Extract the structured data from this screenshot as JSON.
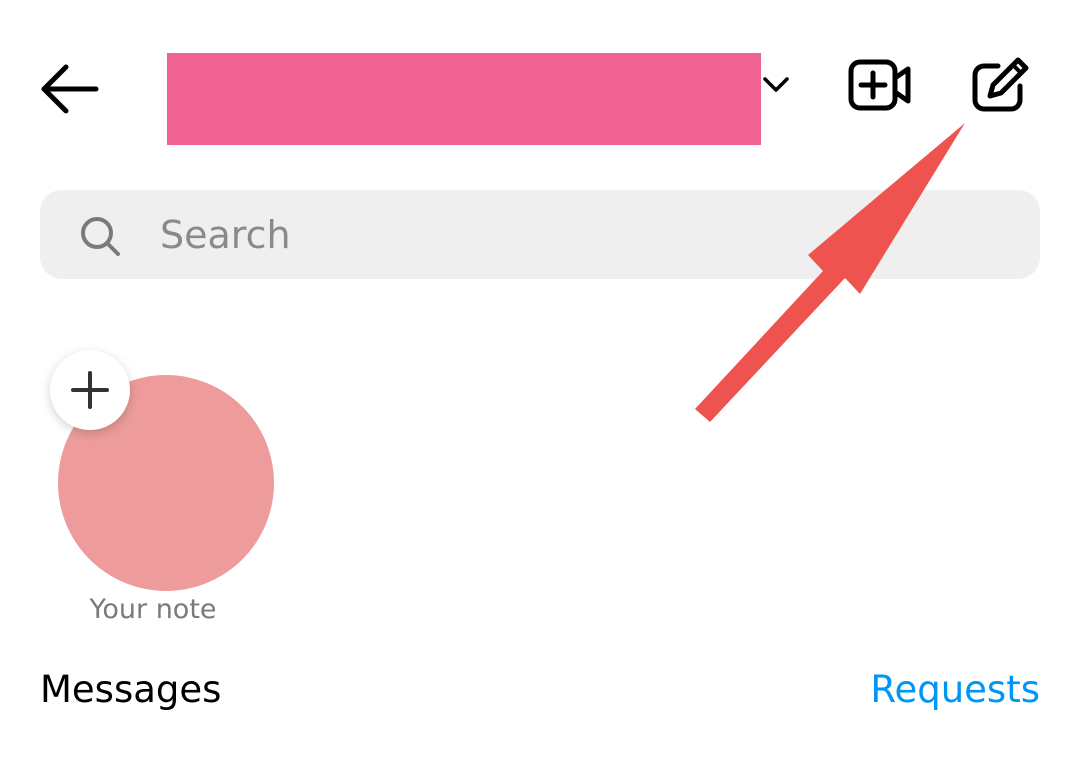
{
  "header": {
    "back_icon": "arrow-left-icon",
    "username_redacted_color": "#f06292",
    "switcher_icon": "chevron-down-icon",
    "video_icon": "video-call-add-icon",
    "compose_icon": "compose-pencil-icon"
  },
  "search": {
    "icon": "search-icon",
    "placeholder": "Search",
    "value": ""
  },
  "note": {
    "avatar_color": "#ed9b9b",
    "add_icon": "plus-icon",
    "label": "Your note"
  },
  "messages": {
    "title": "Messages",
    "requests_label": "Requests",
    "requests_color": "#0095f6"
  },
  "annotation": {
    "arrow_color": "#ef5350"
  }
}
